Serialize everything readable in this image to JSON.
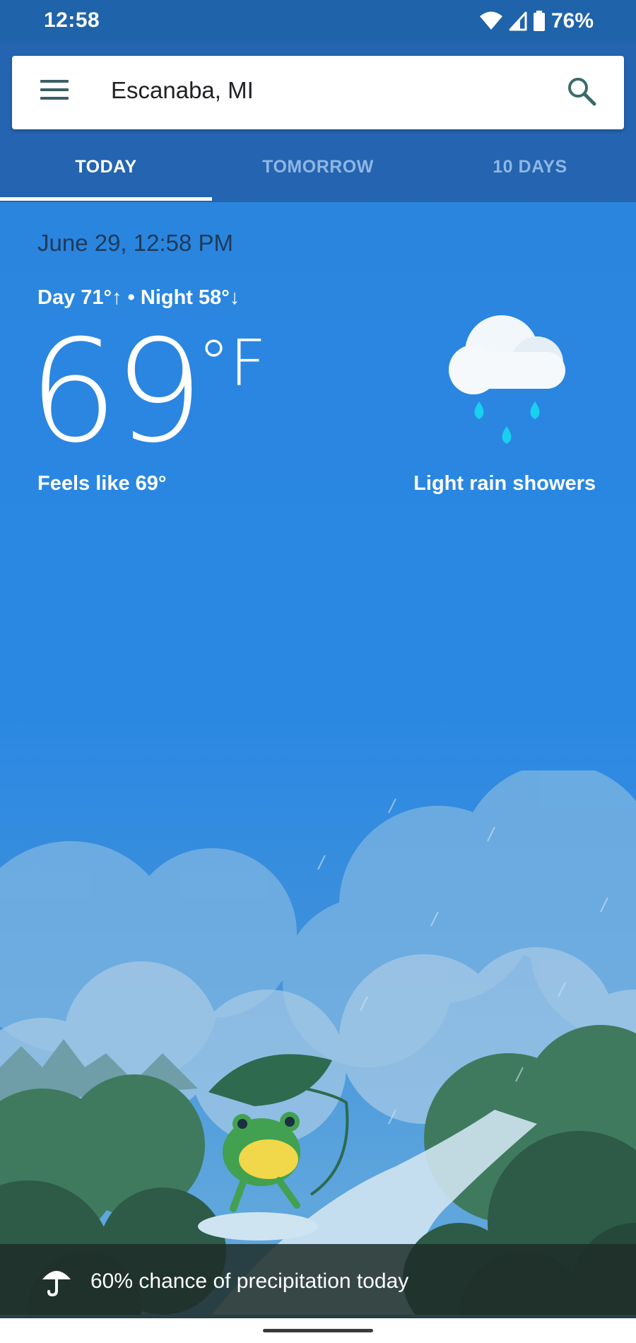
{
  "status_bar": {
    "time": "12:58",
    "battery": "76%",
    "icons": [
      "wifi-icon",
      "signal-icon",
      "battery-icon"
    ]
  },
  "search": {
    "location": "Escanaba, MI",
    "menu_icon": "menu-icon",
    "search_icon": "search-icon"
  },
  "tabs": [
    {
      "label": "TODAY",
      "active": true
    },
    {
      "label": "TOMORROW",
      "active": false
    },
    {
      "label": "10 DAYS",
      "active": false
    }
  ],
  "current": {
    "datetime": "June 29, 12:58 PM",
    "day_night": "Day 71°↑ • Night 58°↓",
    "temperature": "69",
    "unit": "°F",
    "feels_like": "Feels like 69°",
    "condition": "Light rain showers",
    "condition_icon": "cloud-rain-icon"
  },
  "precipitation": {
    "icon": "umbrella-icon",
    "text": "60% chance of precipitation today"
  },
  "colors": {
    "status_bar": "#1f63aa",
    "header": "#2464b0",
    "sky": "#2a86e0",
    "rain_drop": "#18d0f0"
  }
}
